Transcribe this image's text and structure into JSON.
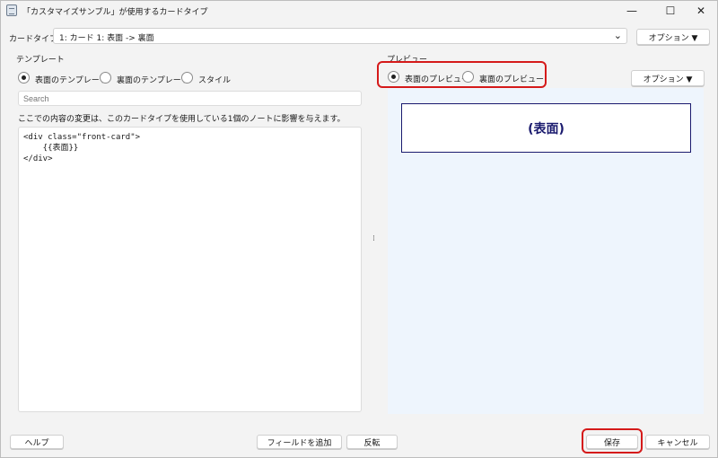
{
  "window": {
    "title": "「カスタマイズサンプル」が使用するカードタイプ",
    "minimize_glyph": "—",
    "maximize_glyph": "☐",
    "close_glyph": "✕"
  },
  "cardtype": {
    "label": "カードタイプ:",
    "selected": "1: カード 1: 表面 -> 裏面",
    "options_button": "オプション ▼"
  },
  "template": {
    "title": "テンプレート",
    "radios": [
      {
        "label": "表面のテンプレート",
        "selected": true
      },
      {
        "label": "裏面のテンプレート",
        "selected": false
      },
      {
        "label": "スタイル",
        "selected": false
      }
    ],
    "search_placeholder": "Search",
    "notice": "ここでの内容の変更は、このカードタイプを使用している1個のノートに影響を与えます。",
    "editor_content": "<div class=\"front-card\">\n    {{表面}}\n</div>"
  },
  "preview": {
    "title": "プレビュー",
    "radios": [
      {
        "label": "表面のプレビュー",
        "selected": true
      },
      {
        "label": "裏面のプレビュー",
        "selected": false
      }
    ],
    "options_button": "オプション ▼",
    "card_text": "(表面)"
  },
  "splitter_glyph": "⁞",
  "footer": {
    "help": "ヘルプ",
    "add_field": "フィールドを追加",
    "flip": "反転",
    "save": "保存",
    "cancel": "キャンセル"
  },
  "colors": {
    "highlight": "#d51a1a",
    "card_text": "#1a1a6e",
    "preview_bg": "#eef5fd"
  }
}
